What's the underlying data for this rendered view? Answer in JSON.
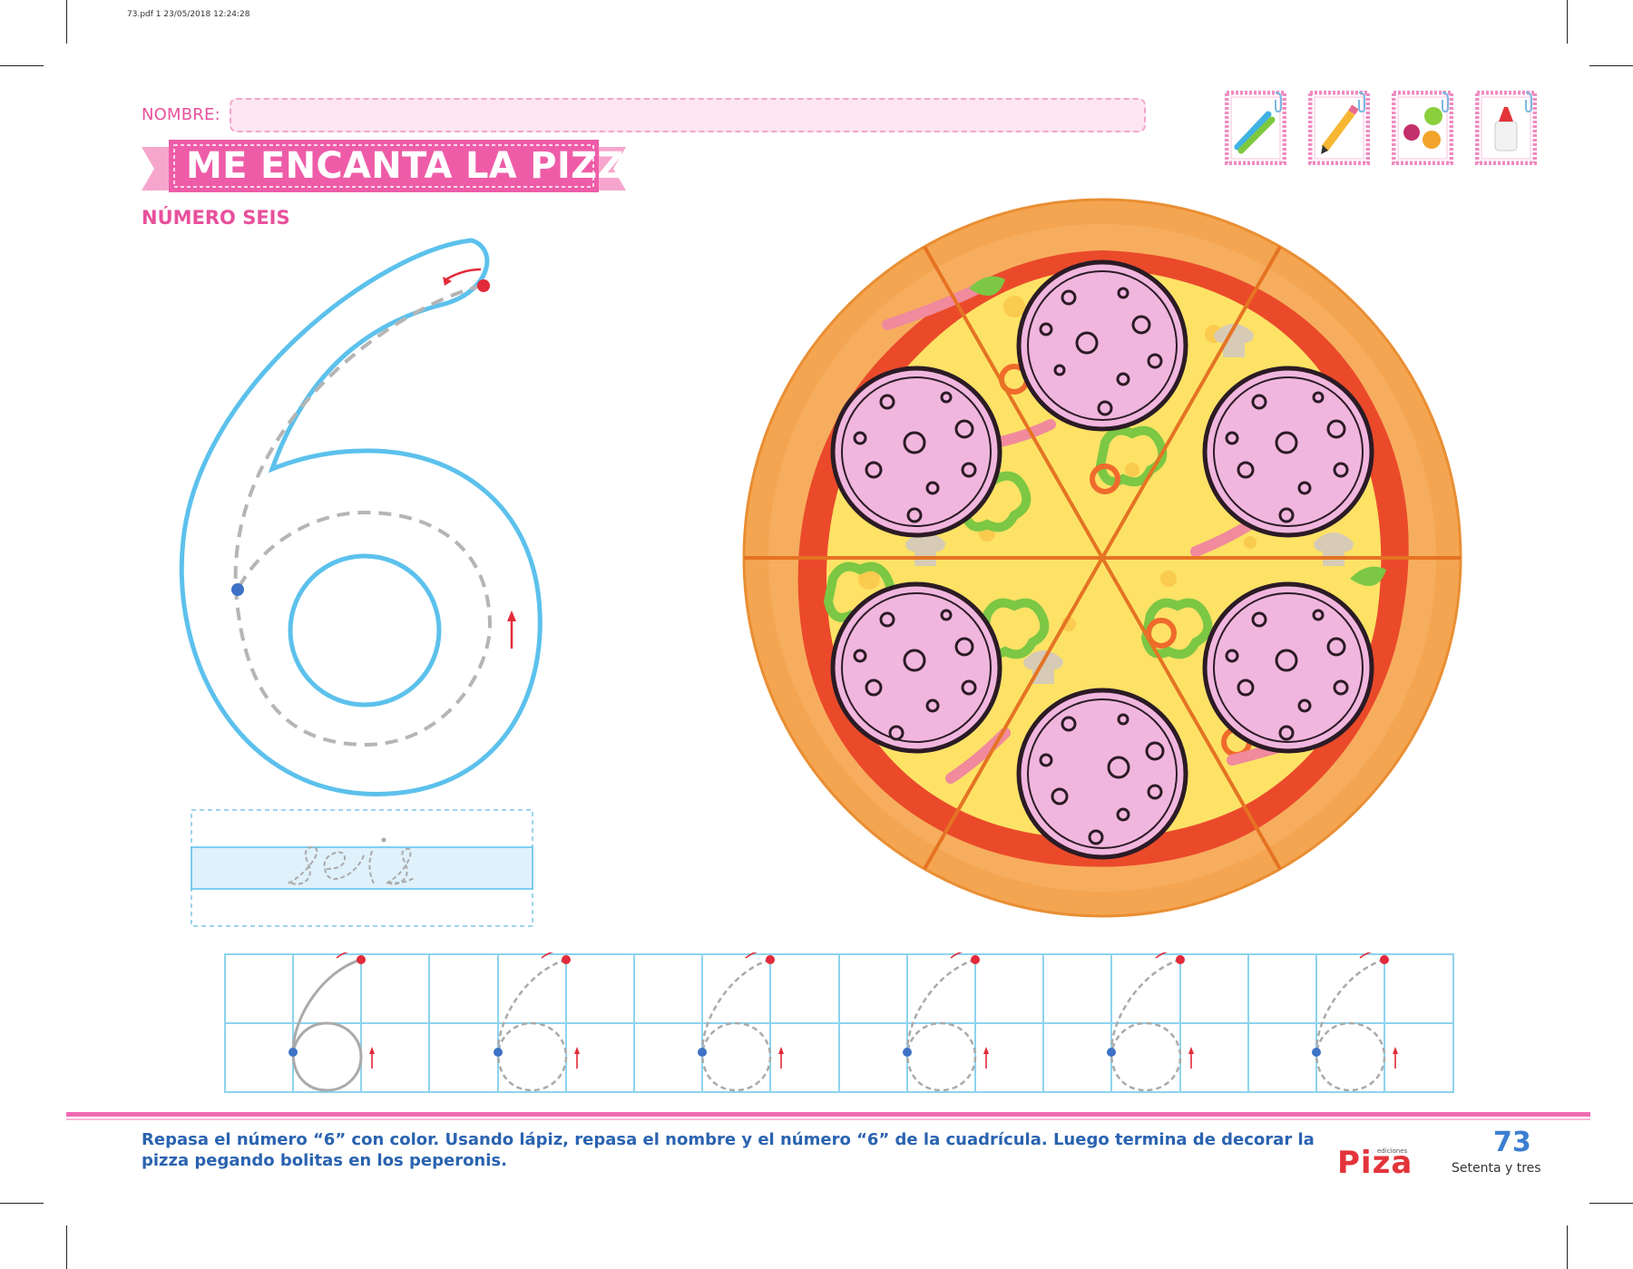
{
  "file_meta": "73.pdf  1  23/05/2018  12:24:28",
  "name_label": "NOMBRE:",
  "name_value": "",
  "title": "ME ENCANTA LA PIZZA",
  "subtitle": "NÚMERO SEIS",
  "word_to_trace": "seis",
  "tools": [
    {
      "icon": "markers-icon"
    },
    {
      "icon": "pencil-icon"
    },
    {
      "icon": "paint-balls-icon"
    },
    {
      "icon": "glue-icon"
    }
  ],
  "instructions": "Repasa el número “6” con color. Usando lápiz, repasa el nombre y el número “6” de la cuadrícula. Luego termina de decorar la pizza pegando bolitas en los peperonis.",
  "brand": {
    "small": "ediciones",
    "name": "Piza"
  },
  "page_number": "73",
  "page_number_words": "Setenta y tres",
  "colors": {
    "pink": "#e8509c",
    "blue_outline": "#5cc1ec",
    "grid": "#8ed3ee",
    "crust": "#f3a04a",
    "sauce": "#ea4a2a",
    "cheese": "#fde266",
    "pepperoni": "#f1b6de",
    "text_blue": "#2a63b0"
  }
}
